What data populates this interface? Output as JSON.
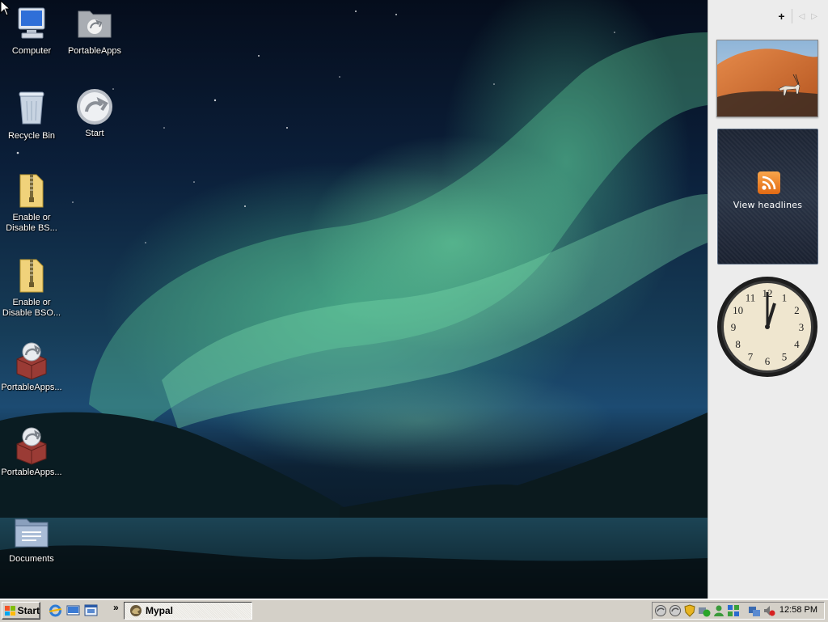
{
  "desktop": {
    "icons": [
      {
        "label": "Computer"
      },
      {
        "label": "PortableApps"
      },
      {
        "label": "Recycle Bin"
      },
      {
        "label": "Start"
      },
      {
        "label": "Enable or Disable BS..."
      },
      {
        "label": "Enable or Disable BSO..."
      },
      {
        "label": "PortableApps..."
      },
      {
        "label": "PortableApps..."
      },
      {
        "label": "Documents"
      }
    ]
  },
  "sidebar": {
    "add_label": "+",
    "prev_label": "◁",
    "next_label": "▷",
    "feed_gadget": {
      "label": "View headlines"
    },
    "clock_gadget": {
      "time": "12:00",
      "numbers": [
        "12",
        "1",
        "2",
        "3",
        "4",
        "5",
        "6",
        "7",
        "8",
        "9",
        "10",
        "11"
      ]
    }
  },
  "taskbar": {
    "start_label": "Start",
    "quicklaunch_more": "»",
    "tasks": [
      {
        "label": "Mypal"
      }
    ],
    "tray_time": "12:58 PM"
  },
  "colors": {
    "aurora": "#5fd39a",
    "sky_dark": "#0b1f3a",
    "taskbar": "#d4d0c8",
    "sidebar": "#ececec",
    "feed_orange": "#f08a2a"
  }
}
